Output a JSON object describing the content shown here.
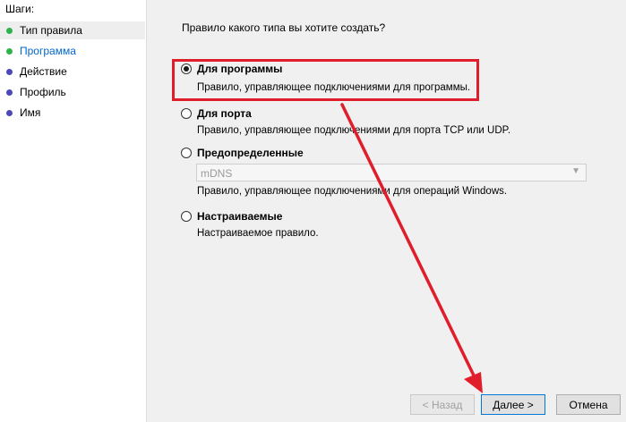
{
  "sidebar": {
    "title": "Шаги:",
    "items": [
      {
        "label": "Тип правила",
        "color": "#2db34a"
      },
      {
        "label": "Программа",
        "color": "#2db34a"
      },
      {
        "label": "Действие",
        "color": "#4b49b9"
      },
      {
        "label": "Профиль",
        "color": "#4b49b9"
      },
      {
        "label": "Имя",
        "color": "#4b49b9"
      }
    ]
  },
  "main": {
    "question": "Правило какого типа вы хотите создать?",
    "options": [
      {
        "label": "Для программы",
        "description": "Правило, управляющее подключениями для программы.",
        "selected": true
      },
      {
        "label": "Для порта",
        "description": "Правило, управляющее подключениями для порта TCP или UDP.",
        "selected": false
      },
      {
        "label": "Предопределенные",
        "description": "Правило, управляющее подключениями для операций Windows.",
        "selected": false
      },
      {
        "label": "Настраиваемые",
        "description": "Настраиваемое правило.",
        "selected": false
      }
    ],
    "predefined_select": {
      "value": "mDNS"
    }
  },
  "buttons": {
    "back": "< Назад",
    "next": "Далее >",
    "cancel": "Отмена"
  },
  "annotation": {
    "color": "#e01e2b"
  }
}
